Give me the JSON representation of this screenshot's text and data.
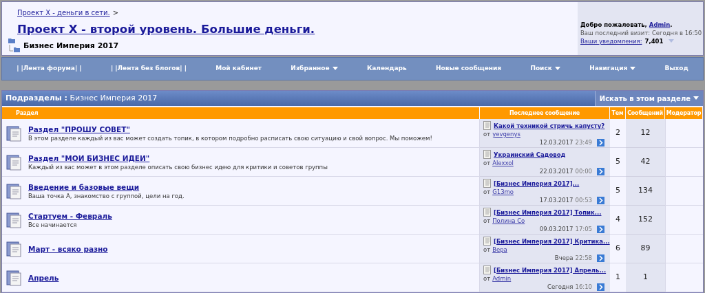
{
  "breadcrumb": {
    "link": "Проект X - деньги в сети.",
    "separator": ">"
  },
  "forum_title": "Проект X - второй уровень. Большие деньги.",
  "current_forum": "Бизнес Империя 2017",
  "user_panel": {
    "welcome": "Добро пожаловать,",
    "user": "Admin",
    "welcome_end": ".",
    "last_visit": "Ваш последний визит: Сегодня в 16:50",
    "notifications_link": "Ваши уведомления:",
    "notifications_count": "7,401"
  },
  "nav": [
    {
      "label": "| |Лента форума| |",
      "has_menu": false
    },
    {
      "label": "| |Лента без блогов| |",
      "has_menu": false
    },
    {
      "label": "Мой кабинет",
      "has_menu": false
    },
    {
      "label": "Избранное",
      "has_menu": true
    },
    {
      "label": "Календарь",
      "has_menu": false
    },
    {
      "label": "Новые сообщения",
      "has_menu": false
    },
    {
      "label": "Поиск",
      "has_menu": true
    },
    {
      "label": "Навигация",
      "has_menu": true
    },
    {
      "label": "Выход",
      "has_menu": false
    }
  ],
  "subforums": {
    "title_label": "Подразделы",
    "title_sep": ":",
    "title_forum": "Бизнес Империя 2017",
    "search_button": "Искать в этом разделе",
    "columns": [
      "Раздел",
      "Последнее сообщение",
      "Тем",
      "Сообщений",
      "Модератор"
    ],
    "rows": [
      {
        "name": "Раздел \"ПРОШУ СОВЕТ\"",
        "description": "В этом разделе каждый из вас может создать топик, в котором подробно расписать свою ситуацию и свой вопрос. Мы поможем!",
        "last_post": {
          "title": "Какой техникой стричь капусту?",
          "from": "от",
          "author": "yevgenys",
          "date": "12.03.2017",
          "time": "23:49"
        },
        "threads": "2",
        "posts": "12"
      },
      {
        "name": "Раздел \"МОИ БИЗНЕС ИДЕИ\"",
        "description": "Каждый из вас может в этом разделе описать свою бизнес идею для критики и советов группы",
        "last_post": {
          "title": "Украинский Садовод",
          "from": "от",
          "author": "Alexxol",
          "date": "22.03.2017",
          "time": "00:00"
        },
        "threads": "5",
        "posts": "42"
      },
      {
        "name": "Введение и базовые вещи",
        "description": "Ваша точка А, знакомство с группой, цели на год.",
        "last_post": {
          "title": "[Бизнес Империя 2017]...",
          "from": "от",
          "author": "G13mo",
          "date": "17.03.2017",
          "time": "00:53"
        },
        "threads": "5",
        "posts": "134"
      },
      {
        "name": "Стартуем - Февраль",
        "description": "Все начинается",
        "last_post": {
          "title": "[Бизнес Империя 2017] Топик...",
          "from": "от",
          "author": "Полина Co",
          "date": "09.03.2017",
          "time": "17:05"
        },
        "threads": "4",
        "posts": "152"
      },
      {
        "name": "Март - всяко разно",
        "last_post": {
          "title": "[Бизнес Империя 2017] Критика...",
          "from": "от",
          "author": "Вера",
          "date": "Вчера",
          "time": "22:58"
        },
        "threads": "6",
        "posts": "89"
      },
      {
        "name": "Апрель",
        "last_post": {
          "title": "[Бизнес Империя 2017] Апрель...",
          "from": "от",
          "author": "Admin",
          "date": "Сегодня",
          "time": "16:10"
        },
        "threads": "1",
        "posts": "1"
      }
    ]
  }
}
